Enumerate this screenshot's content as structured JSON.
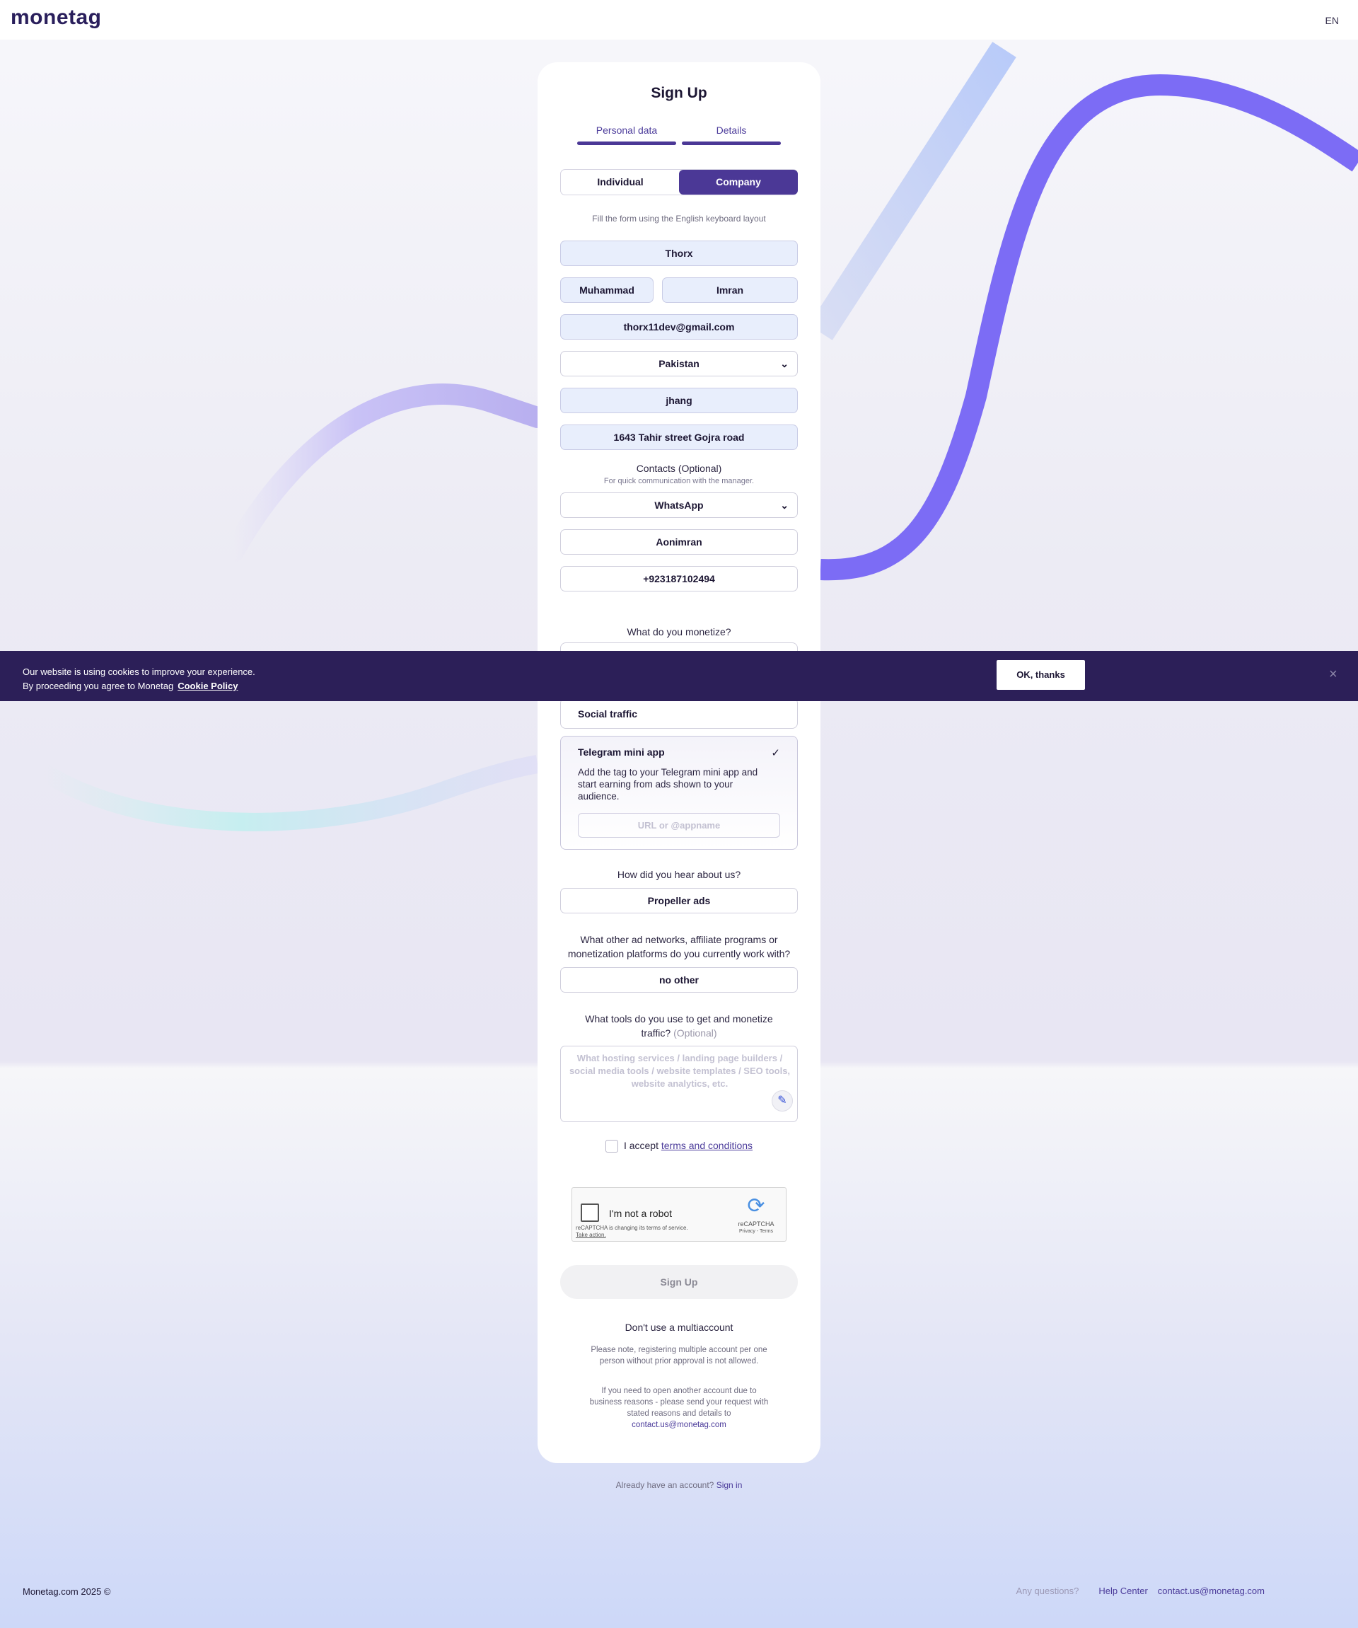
{
  "header": {
    "logo": "monetag",
    "lang": "EN"
  },
  "form": {
    "title": "Sign Up",
    "tabs": [
      "Personal data",
      "Details"
    ],
    "account_types": [
      "Individual",
      "Company"
    ],
    "active_type": "Company",
    "keyboard_hint": "Fill the form using the English keyboard layout",
    "company": "Thorx",
    "first_name": "Muhammad",
    "last_name": "Imran",
    "email": "thorx11dev@gmail.com",
    "country": "Pakistan",
    "city": "jhang",
    "address": "1643 Tahir street Gojra road",
    "contacts_title": "Contacts (Optional)",
    "contacts_sub": "For quick communication with the manager.",
    "messenger": "WhatsApp",
    "messenger_handle": "Aonimran",
    "phone": "+923187102494",
    "monetize_question": "What do you monetize?",
    "options": {
      "social": "Social traffic",
      "telegram_title": "Telegram mini app",
      "telegram_desc": "Add the tag to your Telegram mini app and start earning from ads shown to your audience.",
      "telegram_placeholder": "URL or @appname"
    },
    "hear_question": "How did you hear about us?",
    "hear_answer": "Propeller ads",
    "networks_question": "What other ad networks, affiliate programs or monetization platforms do you currently work with?",
    "networks_answer": "no other",
    "tools_question": "What tools do you use to get and monetize traffic?",
    "tools_optional": "(Optional)",
    "tools_placeholder": "What hosting services / landing page builders / social media tools / website templates / SEO tools, website analytics, etc.",
    "accept_text": "I accept",
    "accept_link": "terms and conditions",
    "submit": "Sign Up",
    "multi_title": "Don't use a multiaccount",
    "multi_p1": "Please note, registering multiple account per one person without prior approval is not allowed.",
    "multi_p2": "If you need to open another account due to business reasons - please send your request with stated reasons and details to",
    "multi_email": "contact.us@monetag.com"
  },
  "recaptcha": {
    "label": "I'm not a robot",
    "warning": "reCAPTCHA is changing its terms of service.",
    "warning_link": "Take action.",
    "brand": "reCAPTCHA",
    "links": "Privacy - Terms"
  },
  "cookie": {
    "line1": "Our website is using cookies to improve your experience.",
    "line2": "By proceeding you agree to Monetag",
    "link": "Cookie Policy",
    "ok": "OK, thanks",
    "close": "×"
  },
  "below": {
    "have_account": "Already have an account?",
    "sign_in": "Sign in"
  },
  "footer": {
    "copyright": "Monetag.com 2025 ©",
    "questions": "Any questions?",
    "help": "Help Center",
    "email": "contact.us@monetag.com"
  }
}
